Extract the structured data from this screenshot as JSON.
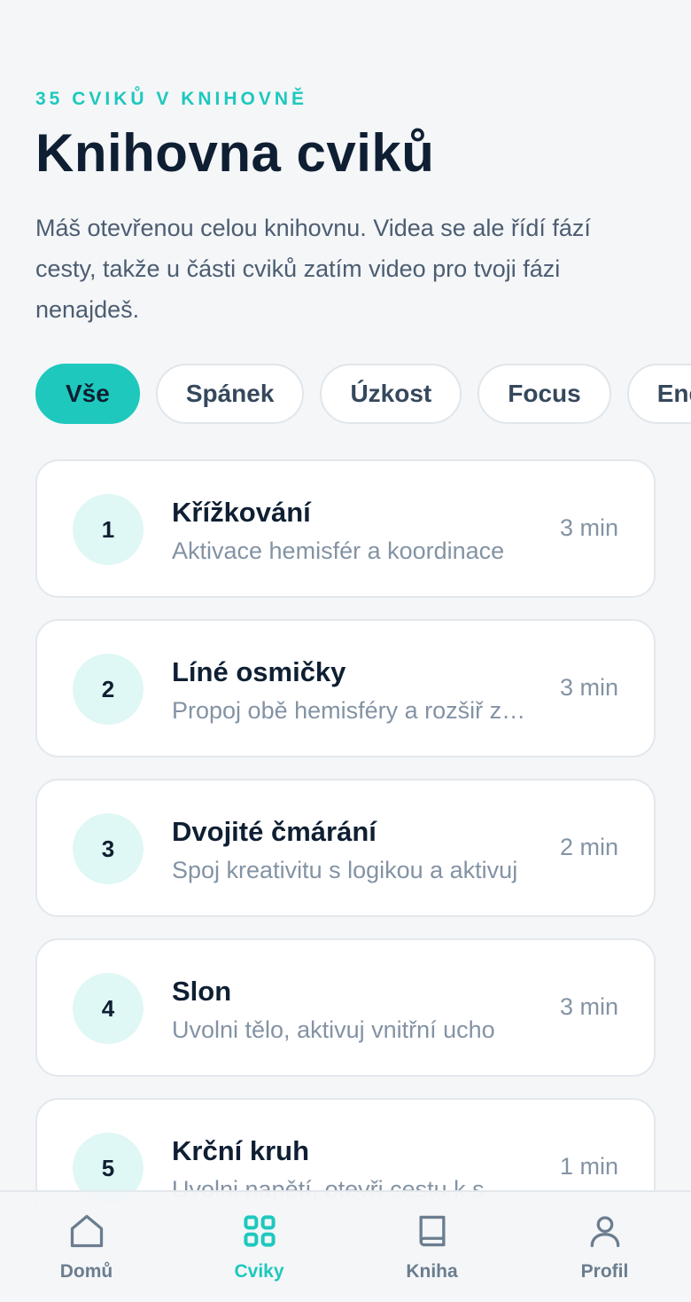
{
  "header": {
    "eyebrow": "35 CVIKŮ V KNIHOVNĚ",
    "title": "Knihovna cviků",
    "intro": "Máš otevřenou celou knihovnu. Videa se ale řídí fází cesty, takže u části cviků zatím video pro tvoji fázi nenajdeš."
  },
  "filters": [
    {
      "label": "Vše",
      "active": true
    },
    {
      "label": "Spánek",
      "active": false
    },
    {
      "label": "Úzkost",
      "active": false
    },
    {
      "label": "Focus",
      "active": false
    },
    {
      "label": "Energie",
      "active": false
    }
  ],
  "exercises": [
    {
      "number": "1",
      "title": "Křížkování",
      "description": "Aktivace hemisfér a koordinace",
      "duration": "3 min"
    },
    {
      "number": "2",
      "title": "Líné osmičky",
      "description": "Propoj obě hemisféry a rozšiř zorné pole",
      "duration": "3 min"
    },
    {
      "number": "3",
      "title": "Dvojité čmárání",
      "description": "Spoj kreativitu s logikou a aktivuj",
      "duration": "2 min"
    },
    {
      "number": "4",
      "title": "Slon",
      "description": "Uvolni tělo, aktivuj vnitřní ucho",
      "duration": "3 min"
    },
    {
      "number": "5",
      "title": "Krční kruh",
      "description": "Uvolni napětí, otevři cestu k s",
      "duration": "1 min"
    }
  ],
  "tabbar": [
    {
      "label": "Domů",
      "icon": "home-icon",
      "active": false
    },
    {
      "label": "Cviky",
      "icon": "grid-icon",
      "active": true
    },
    {
      "label": "Kniha",
      "icon": "book-icon",
      "active": false
    },
    {
      "label": "Profil",
      "icon": "user-icon",
      "active": false
    }
  ],
  "colors": {
    "accent": "#1ec8bd",
    "accent_light": "#dff7f5",
    "text_dark": "#0f1f33",
    "text_muted": "#8393a4",
    "background": "#f4f6f8"
  }
}
